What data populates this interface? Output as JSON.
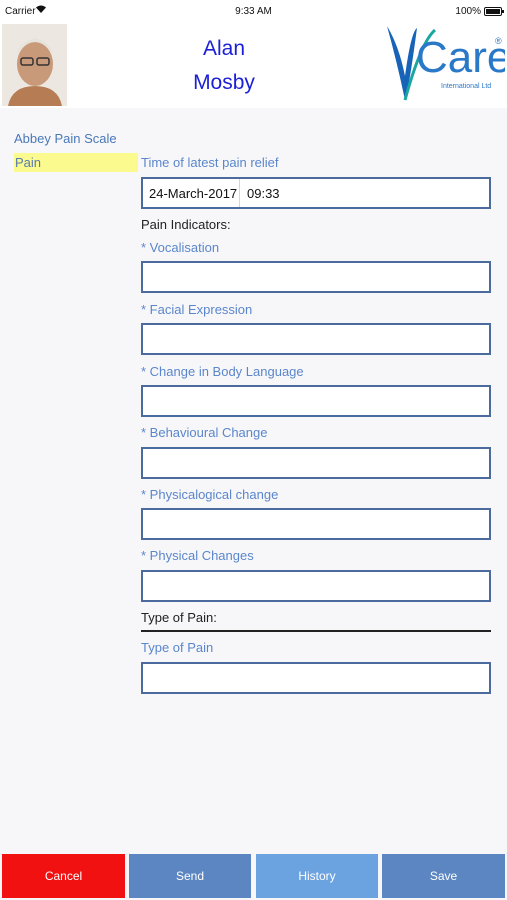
{
  "status_bar": {
    "carrier": "Carrier",
    "time": "9:33 AM",
    "battery": "100%"
  },
  "header": {
    "patient_first_name": "Alan",
    "patient_last_name": "Mosby",
    "logo_text": "Care",
    "logo_letter": "V",
    "logo_subtitle": "International Ltd",
    "logo_registered": "®"
  },
  "form": {
    "title": "Abbey Pain Scale",
    "section": "Pain",
    "latest_relief_label": "Time of latest pain relief",
    "latest_relief_date": "24-March-2017",
    "latest_relief_time": "09:33",
    "indicators_heading": "Pain Indicators:",
    "fields": [
      {
        "label": "* Vocalisation",
        "value": ""
      },
      {
        "label": "* Facial Expression",
        "value": ""
      },
      {
        "label": "* Change in Body Language",
        "value": ""
      },
      {
        "label": "* Behavioural Change",
        "value": ""
      },
      {
        "label": "* Physicalogical change",
        "value": ""
      },
      {
        "label": "* Physical Changes",
        "value": ""
      }
    ],
    "type_heading": "Type of Pain:",
    "type_label": "Type of Pain",
    "type_value": ""
  },
  "buttons": {
    "cancel": "Cancel",
    "send": "Send",
    "history": "History",
    "save": "Save"
  },
  "colors": {
    "brand_blue": "#1b1fd6",
    "label_blue": "#5b86cc",
    "cancel_red": "#f21111",
    "button_blue": "#5b86c1",
    "history_blue": "#6ba2e0",
    "highlight_yellow": "#fbfa8e"
  }
}
